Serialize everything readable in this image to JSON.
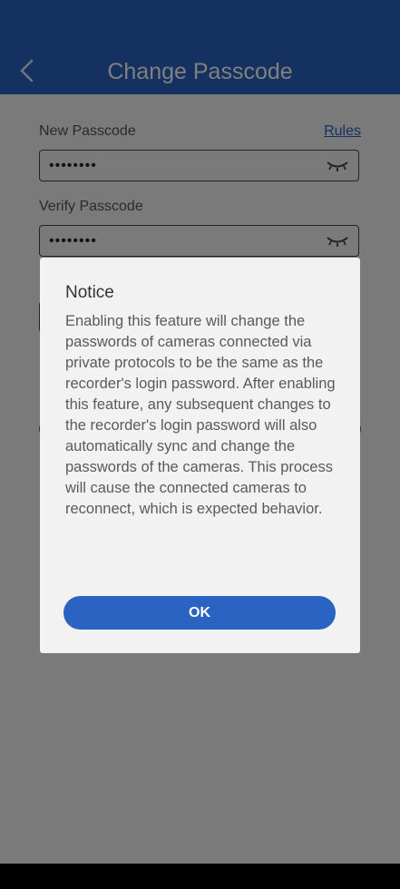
{
  "header": {
    "title": "Change Passcode",
    "background": "#2b63c2",
    "back_icon": "chevron-left-icon"
  },
  "form": {
    "new_passcode_label": "New Passcode",
    "rules_link": "Rules",
    "new_passcode_value": "••••••••",
    "verify_passcode_label": "Verify Passcode",
    "verify_passcode_value": "••••••••",
    "toggle_icon": "eye-closed-icon"
  },
  "dialog": {
    "title": "Notice",
    "body": "Enabling this feature will change the passwords of cameras connected via private protocols to be the same as the recorder's login password. After enabling this feature, any subsequent changes to the recorder's login password will also automatically sync and change the passwords of the cameras. This process will cause the connected cameras to reconnect, which is expected behavior.",
    "ok_label": "OK",
    "accent": "#2b63c2"
  }
}
